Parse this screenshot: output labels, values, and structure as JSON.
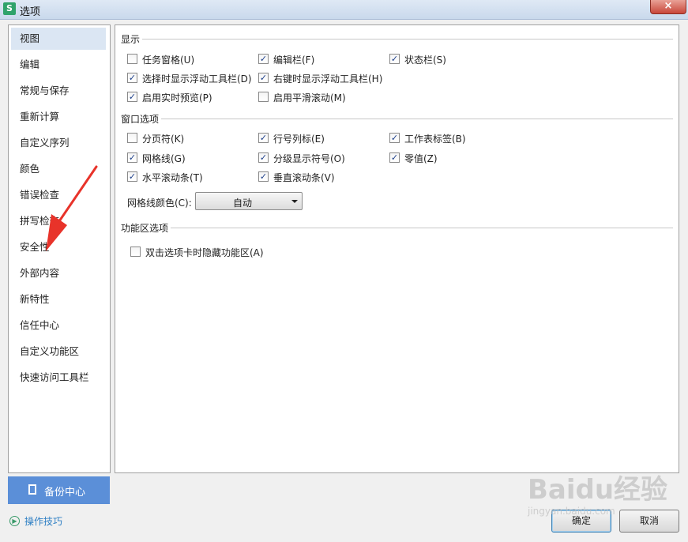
{
  "window": {
    "title": "选项",
    "app_icon": "S",
    "close": "×"
  },
  "sidebar": {
    "items": [
      {
        "label": "视图",
        "selected": true
      },
      {
        "label": "编辑"
      },
      {
        "label": "常规与保存"
      },
      {
        "label": "重新计算"
      },
      {
        "label": "自定义序列"
      },
      {
        "label": "颜色"
      },
      {
        "label": "错误检查"
      },
      {
        "label": "拼写检查"
      },
      {
        "label": "安全性"
      },
      {
        "label": "外部内容"
      },
      {
        "label": "新特性"
      },
      {
        "label": "信任中心"
      },
      {
        "label": "自定义功能区"
      },
      {
        "label": "快速访问工具栏"
      }
    ],
    "backup_label": "备份中心",
    "tips_label": "操作技巧"
  },
  "display": {
    "title": "显示",
    "options": [
      {
        "label": "任务窗格(U)",
        "checked": false
      },
      {
        "label": "编辑栏(F)",
        "checked": true
      },
      {
        "label": "状态栏(S)",
        "checked": true
      },
      {
        "label": "选择时显示浮动工具栏(D)",
        "checked": true
      },
      {
        "label": "右键时显示浮动工具栏(H)",
        "checked": true
      },
      {
        "label": "启用实时预览(P)",
        "checked": true
      },
      {
        "label": "启用平滑滚动(M)",
        "checked": false
      }
    ]
  },
  "window_options": {
    "title": "窗口选项",
    "options": [
      {
        "label": "分页符(K)",
        "checked": false
      },
      {
        "label": "行号列标(E)",
        "checked": true
      },
      {
        "label": "工作表标签(B)",
        "checked": true
      },
      {
        "label": "网格线(G)",
        "checked": true
      },
      {
        "label": "分级显示符号(O)",
        "checked": true
      },
      {
        "label": "零值(Z)",
        "checked": true
      },
      {
        "label": "水平滚动条(T)",
        "checked": true
      },
      {
        "label": "垂直滚动条(V)",
        "checked": true
      }
    ],
    "gridline_color_label": "网格线颜色(C):",
    "gridline_color_value": "自动"
  },
  "ribbon": {
    "title": "功能区选项",
    "options": [
      {
        "label": "双击选项卡时隐藏功能区(A)",
        "checked": false
      }
    ]
  },
  "footer": {
    "ok_label": "确定",
    "cancel_label": "取消"
  },
  "annotation": {
    "color": "#e8332a"
  },
  "watermark": {
    "logo": "Baidu经验",
    "url": "jingyan.baidu.com"
  },
  "colors": {
    "accent": "#5b8fd8",
    "selected_nav": "#dbe6f3",
    "close_red": "#c8473a"
  }
}
